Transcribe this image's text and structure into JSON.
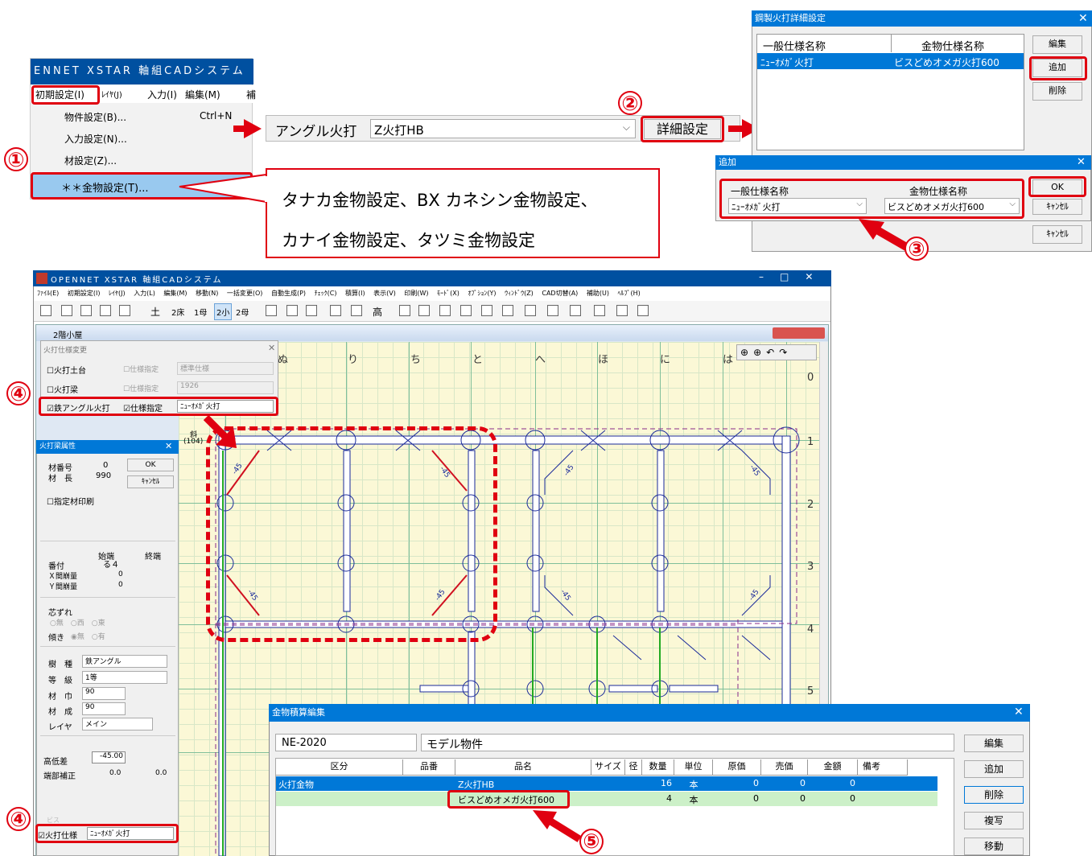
{
  "menu": {
    "app_title": "ENNET XSTAR 軸組CADシステム",
    "bar": [
      "初期設定(I)",
      "ﾚｲﾔ(J)",
      "入力(I)",
      "編集(M)",
      "補"
    ],
    "items": [
      "物件設定(B)...",
      "入力設定(N)...",
      "材設定(Z)...",
      "＊＊金物設定(T)..."
    ],
    "shortcut": "Ctrl+N"
  },
  "callout": {
    "line1": "タナカ金物設定、BX カネシン金物設定、",
    "line2": "カナイ金物設定、タツミ金物設定"
  },
  "angle": {
    "label": "アングル火打",
    "value": "Z火打HB",
    "detail_button": "詳細設定"
  },
  "steps": [
    "①",
    "②",
    "③",
    "④",
    "④",
    "⑤"
  ],
  "detail_dialog": {
    "title": "鋼製火打詳細設定",
    "col1": "一般仕様名称",
    "col2": "金物仕様名称",
    "row_general": "ﾆｭｰｵﾒｶﾞ火打",
    "row_hardware": "ビスどめオメガ火打600",
    "buttons": [
      "編集",
      "追加",
      "削除"
    ],
    "cancel": "ｷｬﾝｾﾙ"
  },
  "add_dialog": {
    "title": "追加",
    "col1": "一般仕様名称",
    "col2": "金物仕様名称",
    "general_value": "ﾆｭｰｵﾒｶﾞ火打",
    "hardware_value": "ビスどめオメガ火打600",
    "ok": "OK",
    "cancel": "ｷｬﾝｾﾙ"
  },
  "main_window": {
    "title": "OPENNET XSTAR 軸組CADシステム",
    "menubar": [
      "ﾌｧｲﾙ(E)",
      "初期設定(I)",
      "ﾚｲﾔ(J)",
      "入力(L)",
      "編集(M)",
      "移動(N)",
      "一括変更(O)",
      "自動生成(P)",
      "ﾁｪｯｸ(C)",
      "積算(I)",
      "表示(V)",
      "印刷(W)",
      "ﾓｰﾄﾞ(X)",
      "ｵﾌﾟｼｮﾝ(Y)",
      "ｳｨﾝﾄﾞｳ(Z)",
      "CAD切替(A)",
      "補助(U)",
      "ﾍﾙﾌﾟ(H)"
    ],
    "toolbar_text": [
      "土",
      "2床",
      "1母",
      "2小",
      "2母",
      "高"
    ],
    "child_title": "2階小屋",
    "col_headers": [
      "ぬ",
      "り",
      "ち",
      "と",
      "へ",
      "ほ",
      "に",
      "は"
    ],
    "row_numbers": [
      "0",
      "1",
      "2",
      "3",
      "4",
      "5"
    ],
    "diag_label": "-45",
    "side_labels": [
      "斜",
      "(104)"
    ]
  },
  "spec_panel": {
    "title": "火打仕様変更",
    "rows": [
      {
        "check": "火打土台",
        "spec": "仕様指定",
        "value": "標準仕様"
      },
      {
        "check": "火打梁",
        "spec": "仕様指定",
        "value": "1926"
      },
      {
        "check": "鉄アングル火打",
        "spec": "仕様指定",
        "value": "ﾆｭｰｵﾒｶﾞ火打"
      }
    ]
  },
  "attr_panel": {
    "title": "火打梁属性",
    "material_no_label": "材番号",
    "material_no": "0",
    "length_label": "材　長",
    "length": "990",
    "ok": "OK",
    "cancel": "ｷｬﾝｾﾙ",
    "print_check": "指定材印刷",
    "start": "始端",
    "end": "終端",
    "address_label": "番付",
    "address": "る４",
    "xgap_label": "Ｘ間崩量",
    "xgap": "0",
    "ygap_label": "Ｙ間崩量",
    "ygap": "0",
    "offset_label": "芯ずれ",
    "offset_opts": [
      "無",
      "西",
      "東"
    ],
    "tilt_label": "傾き",
    "tilt_opts": [
      "無",
      "有"
    ],
    "species_label": "樹　種",
    "species": "鉄アングル",
    "grade_label": "等　級",
    "grade": "1等",
    "width_label": "材　巾",
    "width": "90",
    "depth_label": "材　成",
    "depth": "90",
    "layer_label": "レイヤ",
    "layer": "メイン",
    "height_diff_label": "高低差",
    "height_diff": "-45.00",
    "end_correction_label": "端部補正",
    "end_a": "0.0",
    "end_b": "0.0",
    "screw_label": "ビス",
    "spec_check": "火打仕様",
    "spec_value": "ﾆｭｰｵﾒｶﾞ火打"
  },
  "estimate": {
    "title": "金物積算編集",
    "code": "NE-2020",
    "project": "モデル物件",
    "columns": [
      "区分",
      "品番",
      "品名",
      "サイズ",
      "径",
      "数量",
      "単位",
      "原価",
      "売価",
      "金額",
      "備考"
    ],
    "rows": [
      [
        "火打金物",
        "",
        "Z火打HB",
        "",
        "",
        "16",
        "本",
        "0",
        "0",
        "0",
        ""
      ],
      [
        "",
        "",
        "ビスどめオメガ火打600",
        "",
        "",
        "4",
        "本",
        "0",
        "0",
        "0",
        ""
      ]
    ],
    "buttons": [
      "編集",
      "追加",
      "削除",
      "複写",
      "移動"
    ]
  },
  "colors": {
    "accent": "#0078d7",
    "highlight": "#e00010",
    "cad_bg": "#fbf8d6"
  }
}
